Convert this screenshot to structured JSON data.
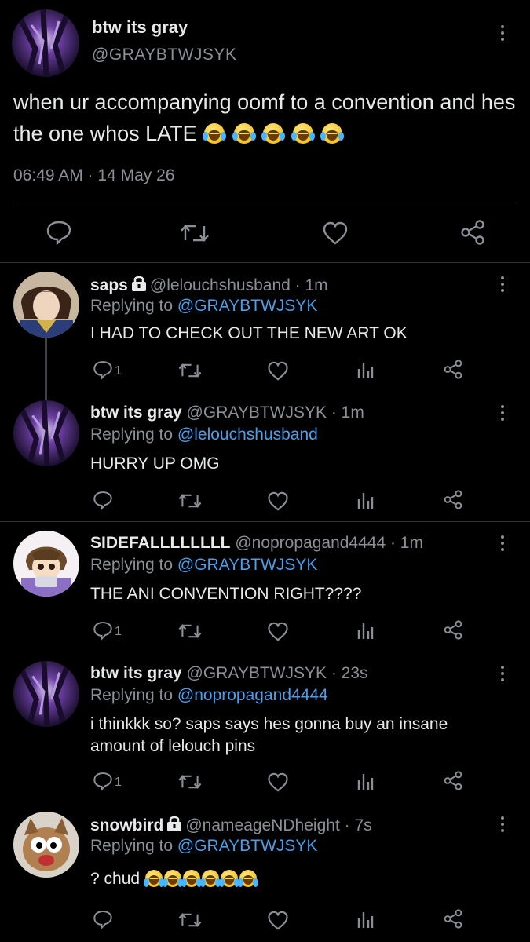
{
  "main_tweet": {
    "display_name": "btw its gray",
    "handle": "@GRAYBTWJSYK",
    "text": "when ur accompanying oomf to a convention and hes the one whos LATE",
    "emoji_count": 5,
    "timestamp": "06:49 AM · 14 May 26",
    "actions": [
      "reply-icon",
      "retweet-icon",
      "like-icon",
      "share-icon"
    ]
  },
  "replies": [
    {
      "display_name": "saps",
      "locked": true,
      "handle_time": "@lelouchshusband · 1m",
      "replying_label": "Replying to",
      "replying_to": "@GRAYBTWJSYK",
      "text": "I HAD TO CHECK OUT THE NEW ART OK",
      "reply_count": "1"
    },
    {
      "display_name": "btw its gray",
      "locked": false,
      "handle_time": "@GRAYBTWJSYK · 1m",
      "replying_label": "Replying to",
      "replying_to": "@lelouchshusband",
      "text": "HURRY UP OMG",
      "reply_count": ""
    },
    {
      "display_name": "SIDEFALLLLLLLL",
      "locked": false,
      "handle_time": "@nopropagand4444 · 1m",
      "replying_label": "Replying to",
      "replying_to": "@GRAYBTWJSYK",
      "text": "THE ANI CONVENTION RIGHT????",
      "reply_count": "1"
    },
    {
      "display_name": "btw its gray",
      "locked": false,
      "handle_time": "@GRAYBTWJSYK · 23s",
      "replying_label": "Replying to",
      "replying_to": "@nopropagand4444",
      "text_line1": "i thinkkk so? saps says hes gonna buy an insane",
      "text_line2": "amount of lelouch pins",
      "reply_count": "1"
    },
    {
      "display_name": "snowbird",
      "locked": true,
      "handle_time": "@nameageNDheight · 7s",
      "replying_label": "Replying to",
      "replying_to": "@GRAYBTWJSYK",
      "text": "? chud",
      "emoji_count": 6,
      "reply_count": ""
    }
  ],
  "colors": {
    "background": "#000000",
    "text": "#e7e9ea",
    "secondary": "#8b9096",
    "mention": "#4a9eeb",
    "divider": "#2f3336"
  }
}
